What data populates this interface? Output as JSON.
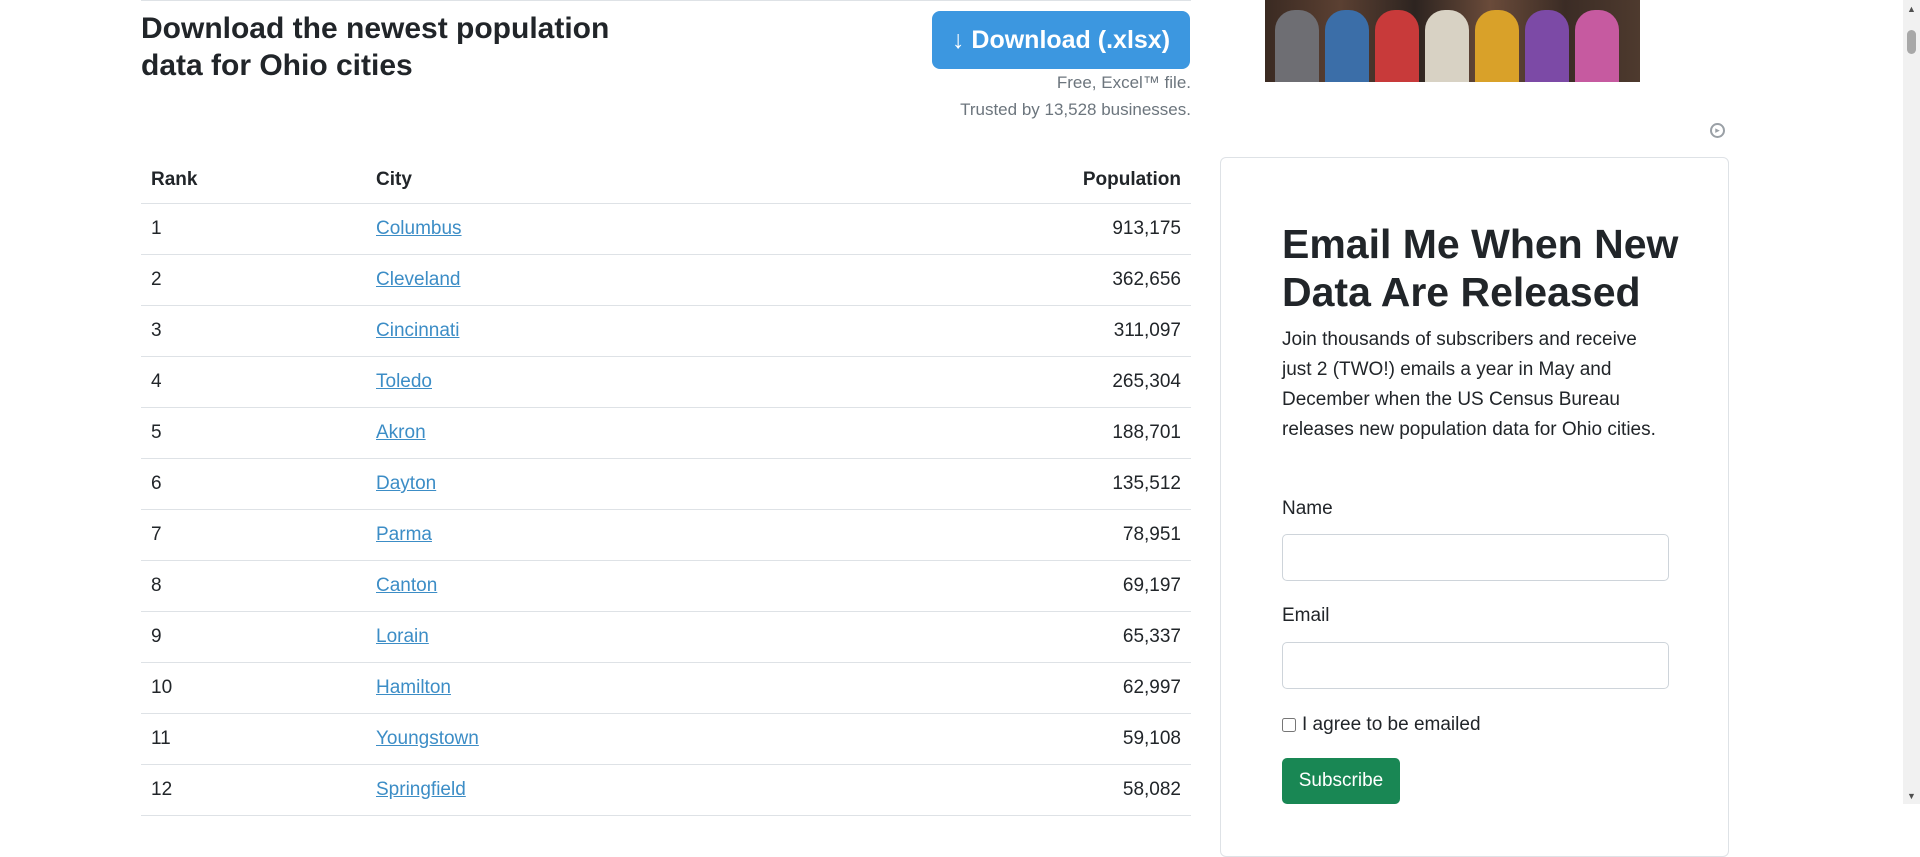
{
  "header": {
    "headline": "Download the newest population data for Ohio cities",
    "download_button": "↓ Download (.xlsx)",
    "note_line1": "Free, Excel™ file.",
    "note_line2": "Trusted by 13,528 businesses."
  },
  "table": {
    "columns": [
      "Rank",
      "City",
      "Population"
    ],
    "rows": [
      {
        "rank": "1",
        "city": "Columbus",
        "population": "913,175"
      },
      {
        "rank": "2",
        "city": "Cleveland",
        "population": "362,656"
      },
      {
        "rank": "3",
        "city": "Cincinnati",
        "population": "311,097"
      },
      {
        "rank": "4",
        "city": "Toledo",
        "population": "265,304"
      },
      {
        "rank": "5",
        "city": "Akron",
        "population": "188,701"
      },
      {
        "rank": "6",
        "city": "Dayton",
        "population": "135,512"
      },
      {
        "rank": "7",
        "city": "Parma",
        "population": "78,951"
      },
      {
        "rank": "8",
        "city": "Canton",
        "population": "69,197"
      },
      {
        "rank": "9",
        "city": "Lorain",
        "population": "65,337"
      },
      {
        "rank": "10",
        "city": "Hamilton",
        "population": "62,997"
      },
      {
        "rank": "11",
        "city": "Youngstown",
        "population": "59,108"
      },
      {
        "rank": "12",
        "city": "Springfield",
        "population": "58,082"
      }
    ]
  },
  "signup": {
    "title": "Email Me When New Data Are Released",
    "blurb": "Join thousands of subscribers and receive just 2 (TWO!) emails a year in May and December when the US Census Bureau releases new population data for Ohio cities.",
    "name_label": "Name",
    "email_label": "Email",
    "agree_label": "I agree to be emailed",
    "subscribe_button": "Subscribe"
  },
  "colors": {
    "download_button": "#3c97e0",
    "link": "#3c8dc6",
    "subscribe_button": "#198754"
  },
  "icons": {
    "ad_choices": "ad-choices-icon",
    "scroll_up": "chevron-up-icon",
    "scroll_down": "chevron-down-icon"
  }
}
